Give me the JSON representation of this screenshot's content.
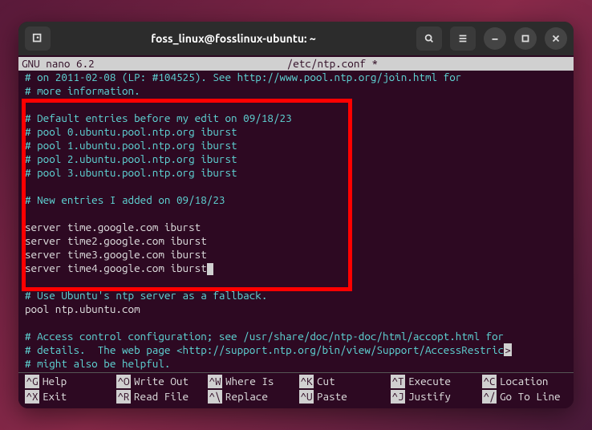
{
  "titlebar": {
    "title": "foss_linux@fosslinux-ubuntu: ~"
  },
  "nano": {
    "app": "  GNU nano 6.2",
    "file": "/etc/ntp.conf *",
    "mod": ""
  },
  "lines": [
    {
      "cls": "comment",
      "t": "# on 2011-02-08 (LP: #104525). See http://www.pool.ntp.org/join.html for"
    },
    {
      "cls": "comment",
      "t": "# more information."
    },
    {
      "cls": "",
      "t": ""
    },
    {
      "cls": "comment",
      "t": "# Default entries before my edit on 09/18/23"
    },
    {
      "cls": "comment",
      "t": "# pool 0.ubuntu.pool.ntp.org iburst"
    },
    {
      "cls": "comment",
      "t": "# pool 1.ubuntu.pool.ntp.org iburst"
    },
    {
      "cls": "comment",
      "t": "# pool 2.ubuntu.pool.ntp.org iburst"
    },
    {
      "cls": "comment",
      "t": "# pool 3.ubuntu.pool.ntp.org iburst"
    },
    {
      "cls": "",
      "t": ""
    },
    {
      "cls": "comment",
      "t": "# New entries I added on 09/18/23"
    },
    {
      "cls": "",
      "t": ""
    },
    {
      "cls": "normal",
      "t": "server time.google.com iburst"
    },
    {
      "cls": "normal",
      "t": "server time2.google.com iburst"
    },
    {
      "cls": "normal",
      "t": "server time3.google.com iburst"
    },
    {
      "cls": "normal",
      "t": "server time4.google.com iburst",
      "cursor": true
    },
    {
      "cls": "",
      "t": ""
    },
    {
      "cls": "comment",
      "t": "# Use Ubuntu's ntp server as a fallback."
    },
    {
      "cls": "normal",
      "t": "pool ntp.ubuntu.com"
    },
    {
      "cls": "",
      "t": ""
    },
    {
      "cls": "comment",
      "t": "# Access control configuration; see /usr/share/doc/ntp-doc/html/accopt.html for"
    },
    {
      "cls": "comment",
      "t": "# details.  The web page <http://support.ntp.org/bin/view/Support/AccessRestric",
      "trail": ">"
    },
    {
      "cls": "comment",
      "t": "# might also be helpful."
    }
  ],
  "shortcuts": [
    {
      "k": "^G",
      "l": "Help"
    },
    {
      "k": "^O",
      "l": "Write Out"
    },
    {
      "k": "^W",
      "l": "Where Is"
    },
    {
      "k": "^K",
      "l": "Cut"
    },
    {
      "k": "^T",
      "l": "Execute"
    },
    {
      "k": "^C",
      "l": "Location"
    },
    {
      "k": "^X",
      "l": "Exit"
    },
    {
      "k": "^R",
      "l": "Read File"
    },
    {
      "k": "^\\",
      "l": "Replace"
    },
    {
      "k": "^U",
      "l": "Paste"
    },
    {
      "k": "^J",
      "l": "Justify"
    },
    {
      "k": "^/",
      "l": "Go To Line"
    }
  ]
}
